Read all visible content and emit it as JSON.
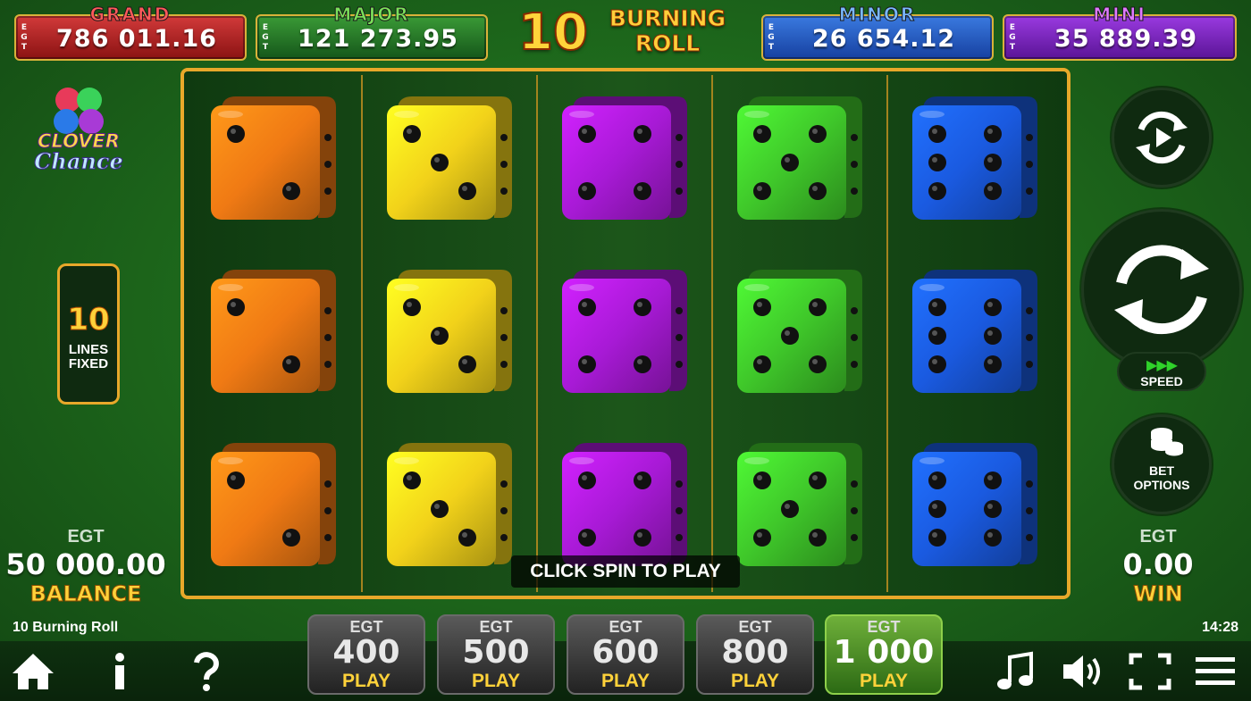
{
  "jackpots": {
    "currency_vertical": "EGT",
    "grand": {
      "name": "GRAND",
      "value": "786 011.16"
    },
    "major": {
      "name": "MAJOR",
      "value": "121 273.95"
    },
    "minor": {
      "name": "MINOR",
      "value": "26 654.12"
    },
    "mini": {
      "name": "MINI",
      "value": "35 889.39"
    }
  },
  "logo": {
    "number": "10",
    "line1": "BURNING",
    "line2": "ROLL"
  },
  "side_logo": {
    "line1": "CLOVER",
    "line2": "Chance"
  },
  "lines": {
    "count": "10",
    "line1": "LINES",
    "line2": "FIXED"
  },
  "reels": [
    {
      "color": "#f07a14",
      "face": 2
    },
    {
      "color": "#f2d21a",
      "face": 3
    },
    {
      "color": "#a81ad6",
      "face": 4
    },
    {
      "color": "#3fc72a",
      "face": 5
    },
    {
      "color": "#1a5ae0",
      "face": 6
    }
  ],
  "banner": "CLICK SPIN TO PLAY",
  "controls": {
    "autoplay_icon": "autoplay-icon",
    "spin_icon": "spin-icon",
    "speed_label": "SPEED",
    "bet_options_line1": "BET",
    "bet_options_line2": "OPTIONS"
  },
  "balance": {
    "currency": "EGT",
    "amount": "50 000.00",
    "label": "BALANCE"
  },
  "win": {
    "currency": "EGT",
    "amount": "0.00",
    "label": "WIN"
  },
  "game_name": "10 Burning Roll",
  "clock": "14:28",
  "bets": [
    {
      "currency": "EGT",
      "value": "400",
      "label": "PLAY",
      "selected": false
    },
    {
      "currency": "EGT",
      "value": "500",
      "label": "PLAY",
      "selected": false
    },
    {
      "currency": "EGT",
      "value": "600",
      "label": "PLAY",
      "selected": false
    },
    {
      "currency": "EGT",
      "value": "800",
      "label": "PLAY",
      "selected": false
    },
    {
      "currency": "EGT",
      "value": "1 000",
      "label": "PLAY",
      "selected": true
    }
  ],
  "bottom_icons": [
    "home-icon",
    "info-icon",
    "help-icon",
    "music-icon",
    "sound-icon",
    "fullscreen-icon",
    "menu-icon"
  ]
}
